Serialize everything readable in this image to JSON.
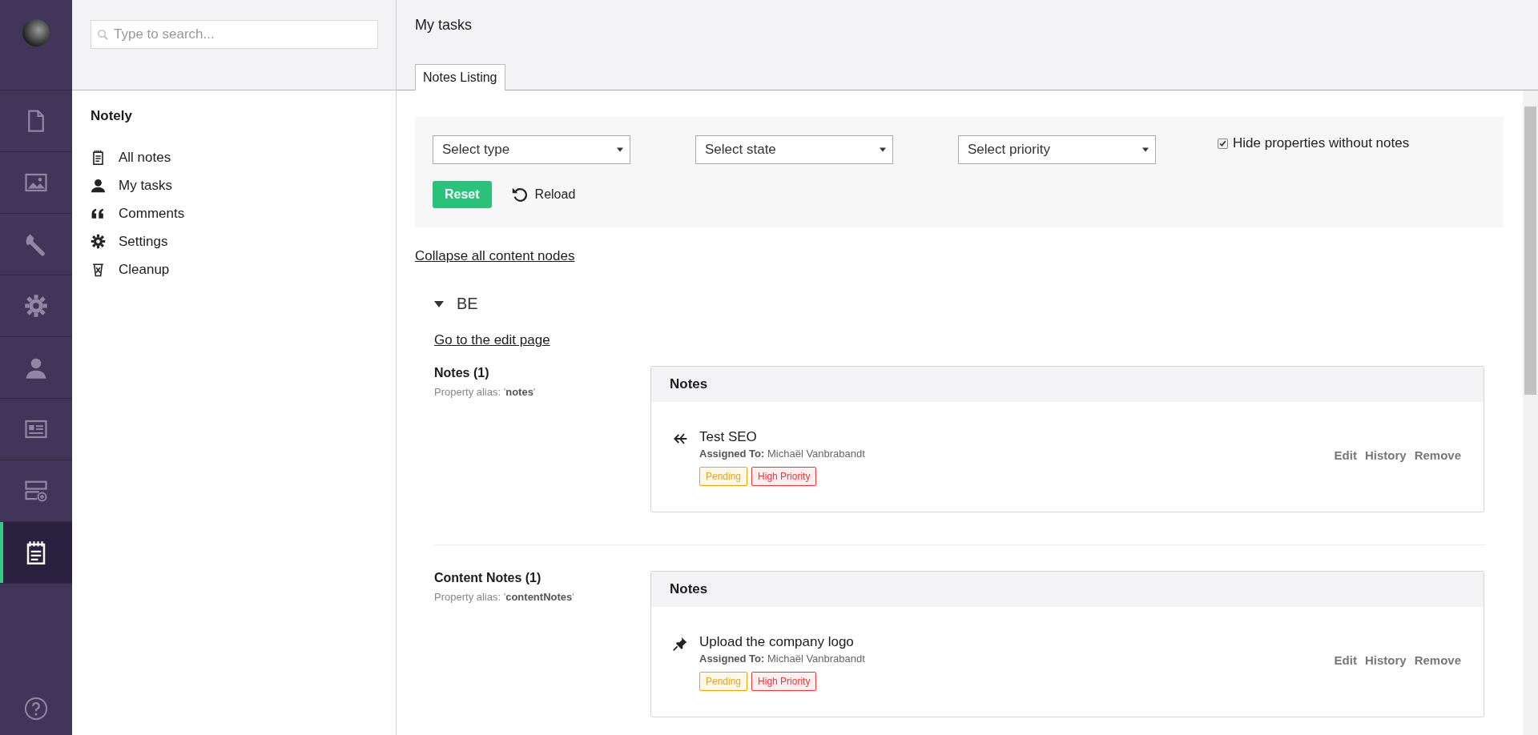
{
  "nav": {
    "items": [
      {
        "kind": "document",
        "selected": false
      },
      {
        "kind": "image",
        "selected": false
      },
      {
        "kind": "wrench",
        "selected": false
      },
      {
        "kind": "gear",
        "selected": false
      },
      {
        "kind": "person",
        "selected": false
      },
      {
        "kind": "card",
        "selected": false
      },
      {
        "kind": "server",
        "selected": false
      },
      {
        "kind": "notes",
        "selected": true
      }
    ]
  },
  "sidebar": {
    "search": {
      "placeholder": "Type to search..."
    },
    "title": "Notely",
    "items": [
      {
        "kind": "notes",
        "label": "All notes"
      },
      {
        "kind": "person",
        "label": "My tasks"
      },
      {
        "kind": "quote",
        "label": "Comments"
      },
      {
        "kind": "gear",
        "label": "Settings"
      },
      {
        "kind": "trash",
        "label": "Cleanup"
      }
    ]
  },
  "main": {
    "title": "My tasks",
    "tabs": [
      {
        "label": "Notes Listing",
        "selected": true
      }
    ],
    "filters": {
      "selects": [
        "Select type",
        "Select state",
        "Select priority"
      ],
      "checkbox": {
        "label": "Hide properties without notes",
        "checked": true
      },
      "reset": "Reset",
      "reload": "Reload"
    },
    "collapse_link": "Collapse all content nodes",
    "nodes": [
      {
        "name": "BE",
        "expanded": true,
        "edit_link": "Go to the edit page",
        "properties": [
          {
            "title": "Notes (1)",
            "alias": "Property alias: '**notes**'",
            "panel_title": "Notes",
            "notes": [
              {
                "kind": "fork",
                "title": "Test SEO",
                "assigned": "**Assigned To:** Michaël Vanbrabandt",
                "tags": [
                  {
                    "label": "Pending",
                    "color": "#e8a800"
                  },
                  {
                    "label": "High Priority",
                    "color": "#e0393e"
                  }
                ],
                "actions": [
                  "Edit",
                  "History",
                  "Remove"
                ]
              }
            ]
          },
          {
            "title": "Content Notes (1)",
            "alias": "Property alias: '**contentNotes**'",
            "panel_title": "Notes",
            "notes": [
              {
                "kind": "pin",
                "title": "Upload the company logo",
                "assigned": "**Assigned To:** Michaël Vanbrabandt",
                "tags": [
                  {
                    "label": "Pending",
                    "color": "#e8a800"
                  },
                  {
                    "label": "High Priority",
                    "color": "#e0393e"
                  }
                ],
                "actions": [
                  "Edit",
                  "History",
                  "Remove"
                ]
              }
            ]
          }
        ]
      }
    ]
  }
}
